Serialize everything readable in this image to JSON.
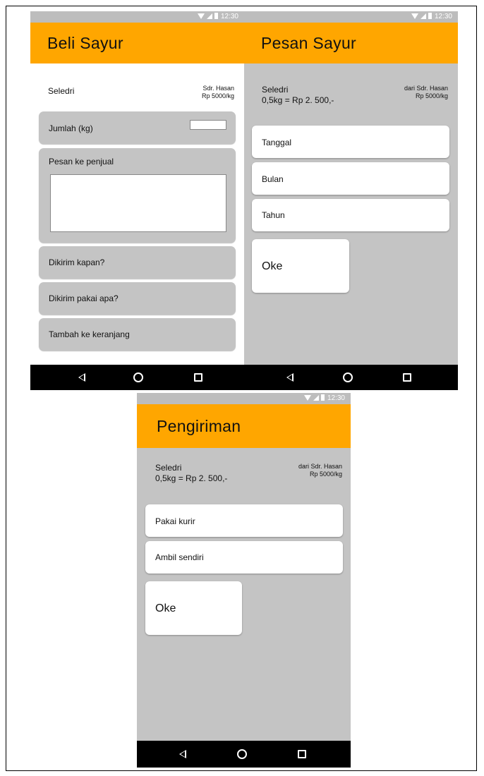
{
  "status_time": "12:30",
  "beli": {
    "title": "Beli Sayur",
    "product": "Seledri",
    "seller": "Sdr. Hasan",
    "price": "Rp 5000/kg",
    "qty_label": "Jumlah (kg)",
    "qty_value": "",
    "note_label": "Pesan ke penjual",
    "note_value": "",
    "when_label": "Dikirim kapan?",
    "how_label": "Dikirim pakai apa?",
    "cart_label": "Tambah ke keranjang"
  },
  "pesan": {
    "title": "Pesan Sayur",
    "product": "Seledri",
    "summary": "0,5kg = Rp 2. 500,-",
    "seller": "dari Sdr. Hasan",
    "price": "Rp 5000/kg",
    "date_label": "Tanggal",
    "month_label": "Bulan",
    "year_label": "Tahun",
    "ok_label": "Oke"
  },
  "kirim": {
    "title": "Pengiriman",
    "product": "Seledri",
    "summary": "0,5kg = Rp 2. 500,-",
    "seller": "dari Sdr. Hasan",
    "price": "Rp 5000/kg",
    "courier_label": "Pakai kurir",
    "pickup_label": "Ambil sendiri",
    "ok_label": "Oke"
  },
  "colors": {
    "appbar": "#ffa600",
    "screen_bg": "#c4c4c4",
    "statusbar": "#bdbdbd",
    "navbar": "#000000"
  },
  "icons": [
    "wifi-icon",
    "cell-signal-icon",
    "battery-icon",
    "back-icon",
    "home-icon",
    "recent-apps-icon"
  ]
}
